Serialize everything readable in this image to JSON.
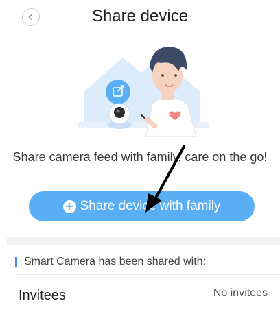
{
  "header": {
    "title": "Share device",
    "back_icon": "chevron-left-icon"
  },
  "main": {
    "message": "Share camera feed with family, care on the go!",
    "share_button": {
      "label": "Share device with family",
      "icon": "plus-circle-icon"
    }
  },
  "shared_section": {
    "text": "Smart Camera has been shared with:",
    "invitees_label": "Invitees",
    "invitees_value": "No invitees"
  },
  "colors": {
    "accent": "#5aaef3",
    "accent_dark": "#3d8fe0",
    "illustration_bg": "#dcecfb"
  }
}
